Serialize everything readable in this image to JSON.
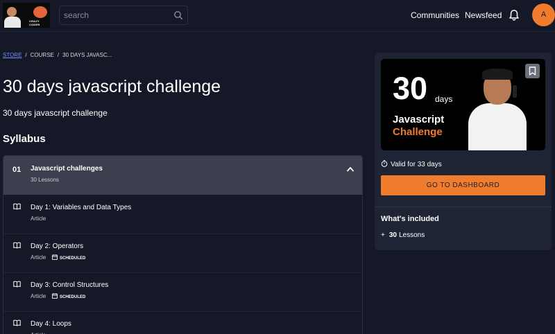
{
  "header": {
    "logo_text": "CRAZY CODER",
    "search_placeholder": "search",
    "nav": [
      "Communities",
      "Newsfeed"
    ],
    "avatar_letter": "A"
  },
  "breadcrumb": [
    "STORE",
    "COURSE",
    "30 DAYS JAVASC..."
  ],
  "course": {
    "title": "30 days javascript challenge",
    "description": "30 days javascript challenge"
  },
  "syllabus": {
    "heading": "Syllabus",
    "module": {
      "number": "01",
      "title": "Javascript challenges",
      "lessons_count": "30 Lessons"
    },
    "lessons": [
      {
        "title": "Day 1: Variables and Data Types",
        "type": "Article",
        "status": ""
      },
      {
        "title": "Day 2: Operators",
        "type": "Article",
        "status": "SCHEDULED"
      },
      {
        "title": "Day 3: Control Structures",
        "type": "Article",
        "status": "SCHEDULED"
      },
      {
        "title": "Day 4: Loops",
        "type": "Article",
        "status": ""
      }
    ]
  },
  "sidebar": {
    "thumbnail": {
      "big_number": "30",
      "days_word": "days",
      "line1": "Javascript",
      "line2": "Challenge"
    },
    "validity": "Valid for 33 days",
    "cta_label": "GO TO DASHBOARD",
    "included_heading": "What's included",
    "included_count": "30",
    "included_label": "Lessons"
  },
  "colors": {
    "background": "#141827",
    "accent": "#f07c2e",
    "link": "#7a8cff",
    "card": "#1f2435",
    "module_header": "#3b3f4e"
  }
}
